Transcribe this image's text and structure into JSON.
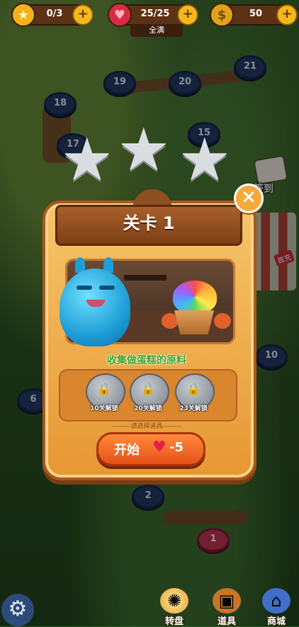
{
  "topbar": {
    "stars": {
      "value": "0/3",
      "icon": "star-icon"
    },
    "lives": {
      "value": "25/25",
      "icon": "heart-icon"
    },
    "coins": {
      "value": "50",
      "icon": "coin-icon"
    },
    "lives_status": "全满"
  },
  "map_levels": [
    {
      "n": "21"
    },
    {
      "n": "20"
    },
    {
      "n": "19"
    },
    {
      "n": "18"
    },
    {
      "n": "17"
    },
    {
      "n": "15"
    },
    {
      "n": "10"
    },
    {
      "n": "6"
    },
    {
      "n": "2"
    },
    {
      "n": "1"
    }
  ],
  "signin_label": "签到",
  "gift_label": "首充",
  "dialog": {
    "title": "关卡 1",
    "stars_earned": 0,
    "stars_total": 3,
    "goal_text": "收集做蛋糕的原料",
    "items": [
      {
        "caption": "10关解锁",
        "icon": "lock-icon"
      },
      {
        "caption": "20关解锁",
        "icon": "lock-icon"
      },
      {
        "caption": "23关解锁",
        "icon": "lock-icon"
      }
    ],
    "hint": "--------请选择道具--------",
    "start_label": "开始",
    "start_cost": "-5",
    "close_symbol": "×"
  },
  "bottom": {
    "wheel_label": "转盘",
    "items_label": "道具",
    "shop_label": "商城"
  },
  "colors": {
    "accent_orange": "#e7511a",
    "panel": "#f7c46a",
    "goal_green": "#3fa42f",
    "level_active": "#c43656",
    "level_node": "#233b68"
  }
}
